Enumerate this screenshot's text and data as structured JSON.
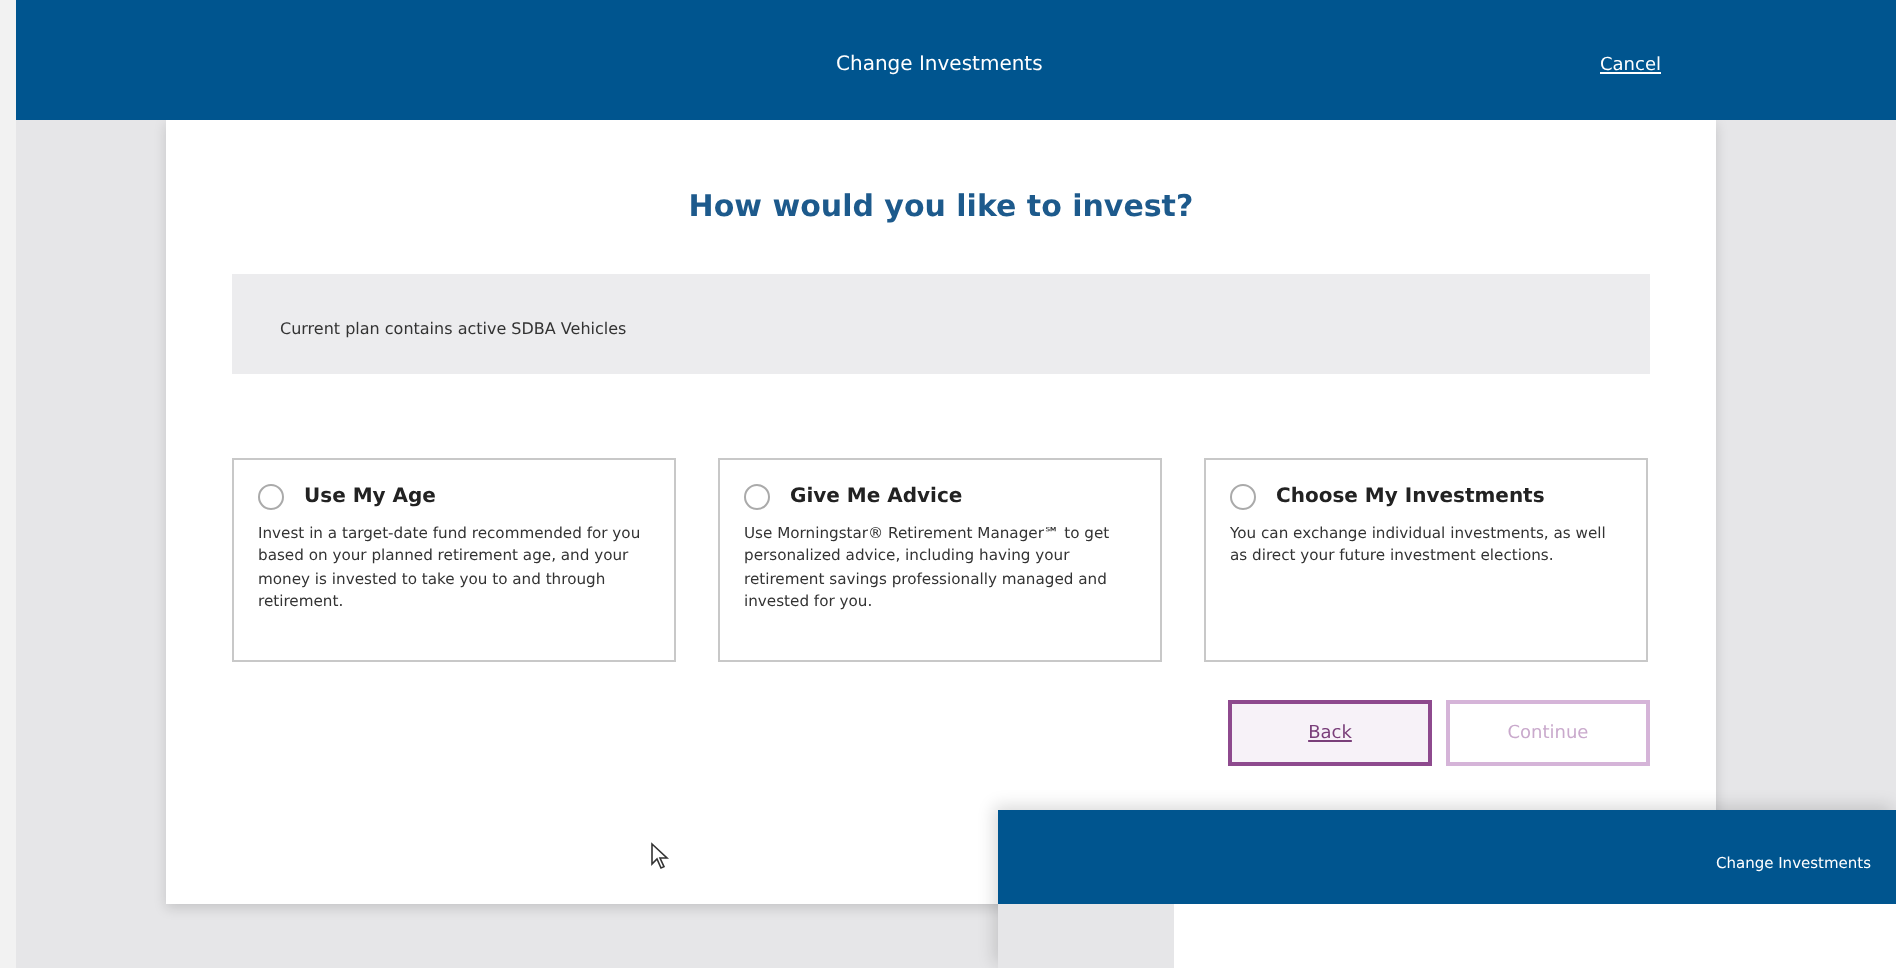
{
  "header": {
    "title": "Change Investments",
    "cancel": "Cancel"
  },
  "heading": "How would you like to invest?",
  "notice": "Current plan contains active SDBA Vehicles",
  "options": [
    {
      "title": "Use My Age",
      "description": "Invest in a target-date fund recommended for you based on your planned retirement age, and your money is invested to take you to and through retirement.",
      "selected": false
    },
    {
      "title": "Give Me Advice",
      "description": "Use Morningstar® Retirement Manager℠ to get personalized advice, including having your retirement savings professionally managed and invested for you.",
      "selected": false
    },
    {
      "title": "Choose My Investments",
      "description": "You can exchange individual investments, as well as direct your future investment elections.",
      "selected": false
    }
  ],
  "buttons": [
    {
      "label": "Back",
      "disabled": false
    },
    {
      "label": "Continue",
      "disabled": true
    }
  ],
  "overlay_window": {
    "title": "Change Investments"
  }
}
